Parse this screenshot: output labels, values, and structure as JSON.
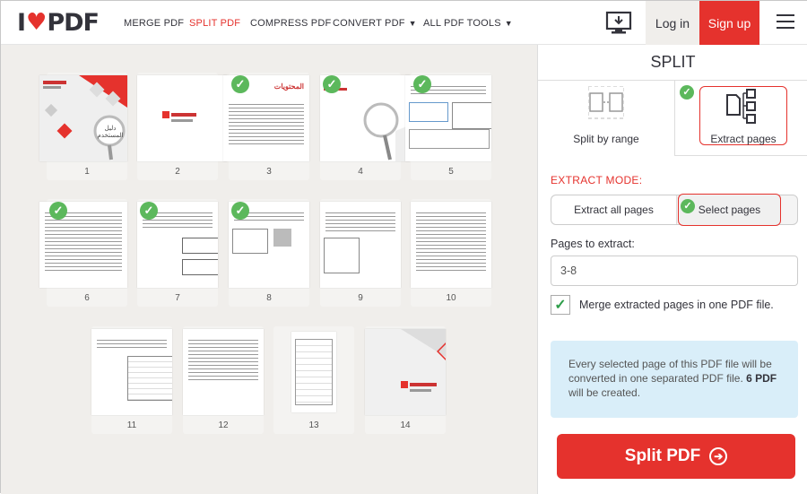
{
  "brand": {
    "logo_left": "I",
    "logo_right": "PDF",
    "heart": "♥"
  },
  "nav": {
    "merge": "MERGE PDF",
    "split": "SPLIT PDF",
    "compress": "COMPRESS PDF",
    "convert": "CONVERT PDF",
    "all_tools": "ALL PDF TOOLS"
  },
  "auth": {
    "login": "Log in",
    "signup": "Sign up"
  },
  "pages": [
    {
      "num": "1",
      "checked": false
    },
    {
      "num": "2",
      "checked": false
    },
    {
      "num": "3",
      "checked": true
    },
    {
      "num": "4",
      "checked": true
    },
    {
      "num": "5",
      "checked": true
    },
    {
      "num": "6",
      "checked": true
    },
    {
      "num": "7",
      "checked": true
    },
    {
      "num": "8",
      "checked": true
    },
    {
      "num": "9",
      "checked": false
    },
    {
      "num": "10",
      "checked": false
    },
    {
      "num": "11",
      "checked": false
    },
    {
      "num": "12",
      "checked": false
    },
    {
      "num": "13",
      "checked": false
    },
    {
      "num": "14",
      "checked": false
    }
  ],
  "thumb_text": {
    "page3_heading": "المحتويات",
    "page1_title": "دليل المستخدم"
  },
  "panel": {
    "title": "SPLIT",
    "tab_range": "Split by range",
    "tab_extract": "Extract pages",
    "mode_label": "EXTRACT MODE:",
    "mode_all": "Extract all pages",
    "mode_select": "Select pages",
    "pages_label": "Pages to extract:",
    "pages_value": "3-8",
    "merge_label": "Merge extracted pages in one PDF file.",
    "info_text_1": "Every selected page of this PDF file will be converted in one separated PDF file.",
    "info_bold": "6 PDF",
    "info_text_2": "will be created.",
    "cta": "Split PDF"
  },
  "colors": {
    "accent": "#e5322d",
    "check": "#5cb85c",
    "info_bg": "#d9eef9"
  }
}
